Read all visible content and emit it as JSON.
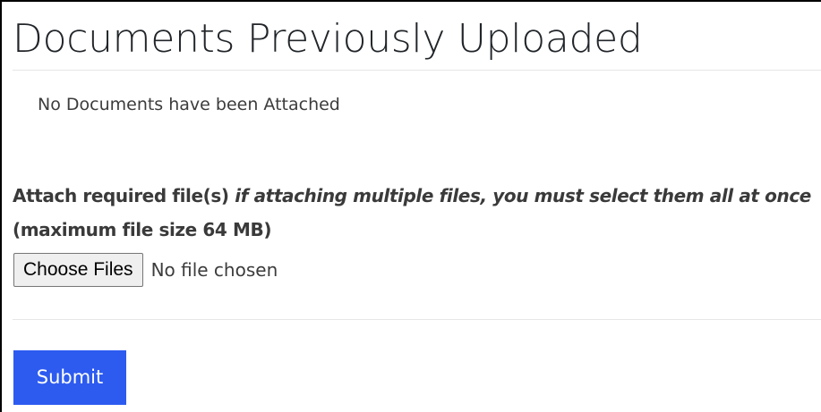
{
  "page": {
    "title": "Documents Previously Uploaded"
  },
  "documents": {
    "empty_message": "No Documents have been Attached"
  },
  "attach": {
    "label_prefix": "Attach required file(s)",
    "label_italic": "if attaching multiple files, you must select them all at once",
    "label_suffix": "(maximum file size 64 MB)"
  },
  "file_input": {
    "button_label": "Choose Files",
    "status": "No file chosen"
  },
  "form": {
    "submit_label": "Submit"
  },
  "colors": {
    "submit_background": "#2d5bf0",
    "submit_text": "#ffffff",
    "body_text": "#3c3c3c",
    "title_text": "#212529",
    "divider": "#e6e6e6"
  }
}
